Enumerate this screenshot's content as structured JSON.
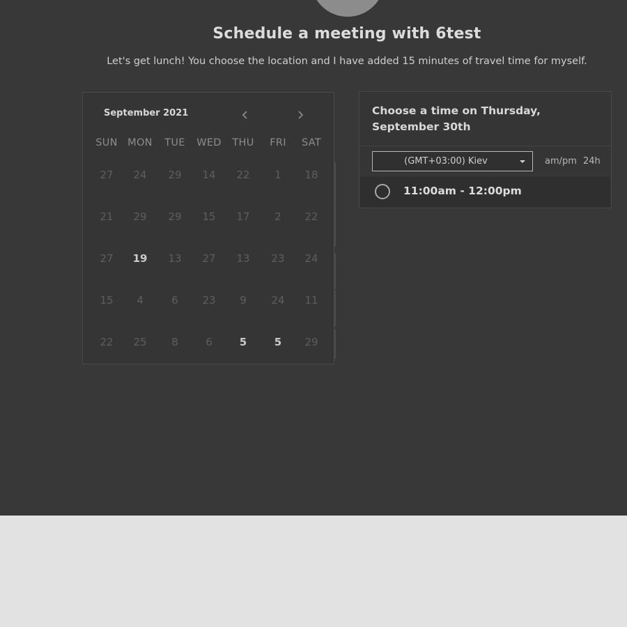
{
  "header": {
    "title": "Schedule a meeting with 6test",
    "subtitle": "Let's get lunch! You choose the location and I have added 15 minutes of travel time for myself."
  },
  "calendar": {
    "month_label": "September 2021",
    "prev_icon": "chevron-left-icon",
    "next_icon": "chevron-right-icon",
    "weekdays": [
      "SUN",
      "MON",
      "TUE",
      "WED",
      "THU",
      "FRI",
      "SAT"
    ],
    "weeks": [
      [
        "27",
        "24",
        "29",
        "14",
        "22",
        "1",
        "18"
      ],
      [
        "21",
        "29",
        "29",
        "15",
        "17",
        "2",
        "22"
      ],
      [
        "27",
        "19",
        "13",
        "27",
        "13",
        "23",
        "24"
      ],
      [
        "15",
        "4",
        "6",
        "23",
        "9",
        "24",
        "11"
      ],
      [
        "22",
        "25",
        "8",
        "6",
        "5",
        "5",
        "29"
      ]
    ],
    "available_days": [
      [
        2,
        1
      ],
      [
        4,
        4
      ],
      [
        4,
        5
      ]
    ]
  },
  "time_panel": {
    "heading": "Choose a time on Thursday, September 30th",
    "timezone": "(GMT+03:00) Kiev",
    "format_ampm": "am/pm",
    "format_24h": "24h",
    "slots": [
      "11:00am - 12:00pm"
    ]
  },
  "colors": {
    "panel_bg": "#383838",
    "page_bg": "#e2e2e2",
    "text": "#dcdcdc"
  }
}
